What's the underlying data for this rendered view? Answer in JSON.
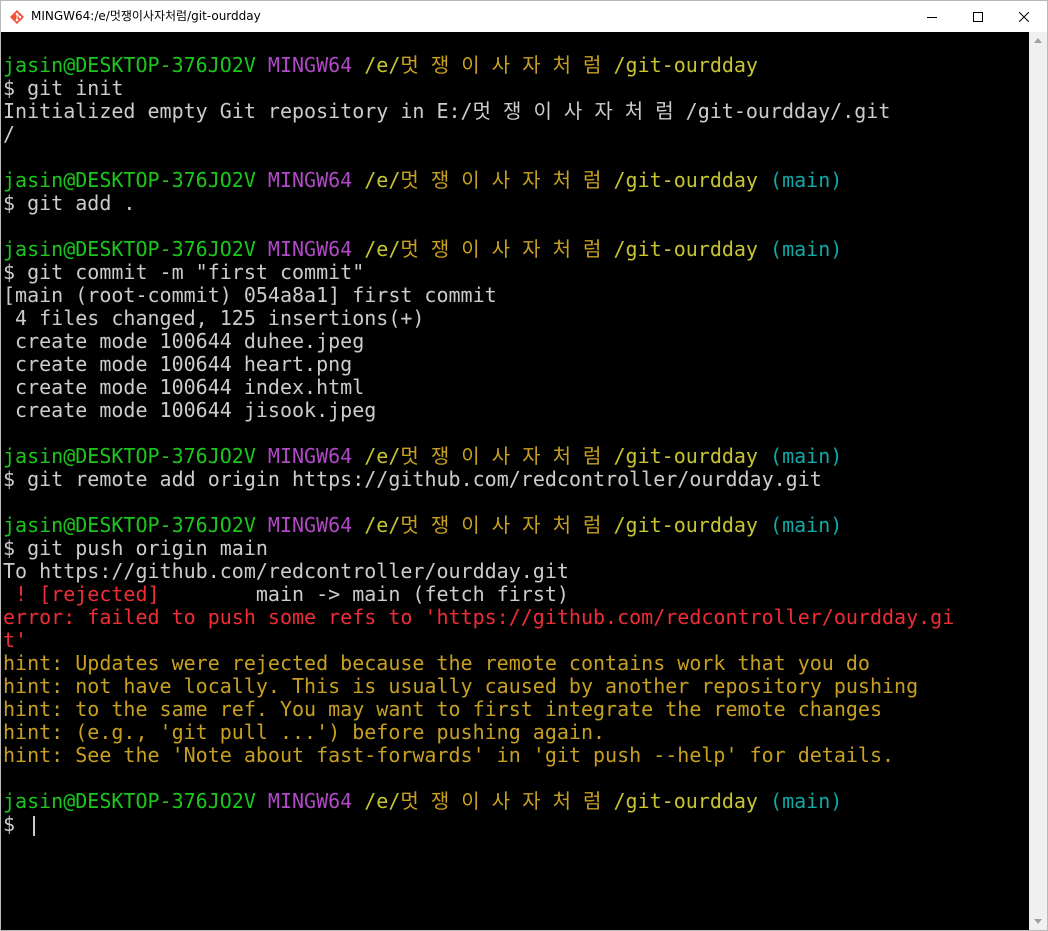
{
  "window": {
    "title": "MINGW64:/e/멋쟁이사자처럼/git-ourdday",
    "icon": "git-bash-icon",
    "minimize_icon": "minimize-icon",
    "maximize_icon": "maximize-icon",
    "close_icon": "close-icon"
  },
  "prompt": {
    "user_host": "jasin@DESKTOP-376JO2V",
    "env": "MINGW64",
    "path_prefix": "/e/",
    "path_korean": "멋 쟁 이 사 자 처 럼 ",
    "path_suffix": "/git-ourdday",
    "branch": "(main)",
    "dollar": "$ "
  },
  "colors": {
    "user_host": "#1cc71c",
    "env": "#b148c6",
    "path": "#c7c433",
    "branch": "#11a8a8",
    "error": "#ee2d37",
    "hint": "#c7a021",
    "text": "#cccccc"
  },
  "output": {
    "cmd_init": "git init",
    "init_out_1": "Initialized empty Git repository in E:/멋 쟁 이 사 자 처 럼 /git-ourdday/.git",
    "init_out_2": "/",
    "cmd_add": "git add .",
    "cmd_commit": "git commit -m \"first commit\"",
    "commit_out_1": "[main (root-commit) 054a8a1] first commit",
    "commit_out_2": " 4 files changed, 125 insertions(+)",
    "commit_out_3": " create mode 100644 duhee.jpeg",
    "commit_out_4": " create mode 100644 heart.png",
    "commit_out_5": " create mode 100644 index.html",
    "commit_out_6": " create mode 100644 jisook.jpeg",
    "cmd_remote": "git remote add origin https://github.com/redcontroller/ourdday.git",
    "cmd_push": "git push origin main",
    "push_out_1": "To https://github.com/redcontroller/ourdday.git",
    "push_rejected_tag": " ! [rejected]",
    "push_rejected_rest": "        main -> main (fetch first)",
    "error_1": "error: failed to push some refs to 'https://github.com/redcontroller/ourdday.gi",
    "error_2": "t'",
    "hint_1": "hint: Updates were rejected because the remote contains work that you do",
    "hint_2": "hint: not have locally. This is usually caused by another repository pushing",
    "hint_3": "hint: to the same ref. You may want to first integrate the remote changes",
    "hint_4": "hint: (e.g., 'git pull ...') before pushing again.",
    "hint_5": "hint: See the 'Note about fast-forwards' in 'git push --help' for details."
  }
}
